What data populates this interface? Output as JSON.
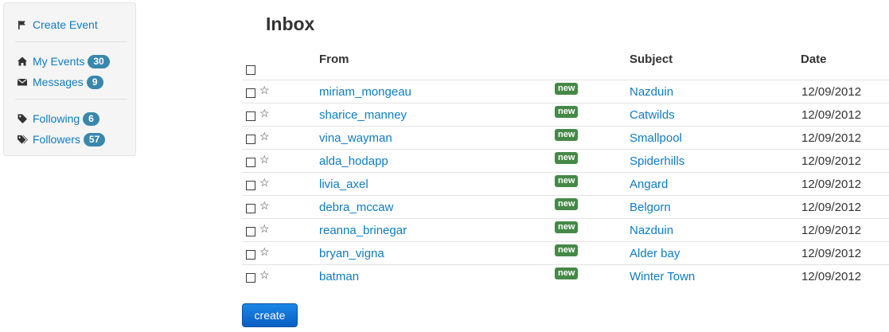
{
  "sidebar": {
    "create_event": "Create Event",
    "my_events": {
      "label": "My Events",
      "count": "30"
    },
    "messages": {
      "label": "Messages",
      "count": "9"
    },
    "following": {
      "label": "Following",
      "count": "6"
    },
    "followers": {
      "label": "Followers",
      "count": "57"
    }
  },
  "inbox": {
    "title": "Inbox",
    "columns": {
      "from": "From",
      "subject": "Subject",
      "date": "Date"
    },
    "star": "☆",
    "rows": [
      {
        "from": "miriam_mongeau",
        "badge": "new",
        "subject": "Nazduin",
        "date": "12/09/2012"
      },
      {
        "from": "sharice_manney",
        "badge": "new",
        "subject": "Catwilds",
        "date": "12/09/2012"
      },
      {
        "from": "vina_wayman",
        "badge": "new",
        "subject": "Smallpool",
        "date": "12/09/2012"
      },
      {
        "from": "alda_hodapp",
        "badge": "new",
        "subject": "Spiderhills",
        "date": "12/09/2012"
      },
      {
        "from": "livia_axel",
        "badge": "new",
        "subject": "Angard",
        "date": "12/09/2012"
      },
      {
        "from": "debra_mccaw",
        "badge": "new",
        "subject": "Belgorn",
        "date": "12/09/2012"
      },
      {
        "from": "reanna_brinegar",
        "badge": "new",
        "subject": "Nazduin",
        "date": "12/09/2012"
      },
      {
        "from": "bryan_vigna",
        "badge": "new",
        "subject": "Alder bay",
        "date": "12/09/2012"
      },
      {
        "from": "batman",
        "badge": "new",
        "subject": "Winter Town",
        "date": "12/09/2012"
      }
    ],
    "create_button": "create"
  },
  "colors": {
    "link": "#0e7cc2",
    "badge_info": "#3a87ad",
    "badge_new": "#468847",
    "button": "#0a5fc4"
  },
  "icons": {
    "create_event": "flag-icon",
    "my_events": "home-icon",
    "messages": "envelope-icon",
    "following": "tag-icon",
    "followers": "tags-icon",
    "row_star": "star-icon"
  }
}
